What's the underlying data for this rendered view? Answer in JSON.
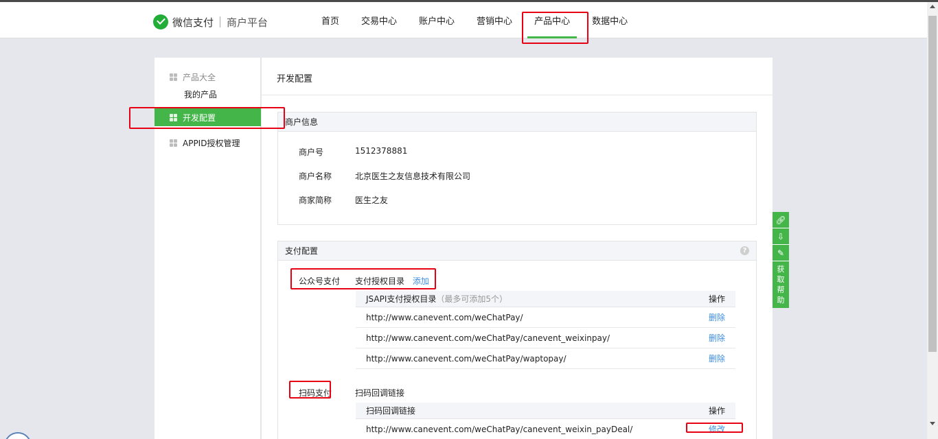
{
  "brand": {
    "name": "微信支付",
    "sub": "商户平台"
  },
  "nav": [
    "首页",
    "交易中心",
    "账户中心",
    "营销中心",
    "产品中心",
    "数据中心"
  ],
  "sidebar": {
    "group1": "产品大全",
    "my_products": "我的产品",
    "active": "开发配置",
    "appid": "APPID授权管理"
  },
  "main": {
    "title": "开发配置",
    "merchant": {
      "head": "商户信息",
      "rows": [
        {
          "k": "商户号",
          "v": "1512378881"
        },
        {
          "k": "商户名称",
          "v": "北京医生之友信息技术有限公司"
        },
        {
          "k": "商家简称",
          "v": "医生之友"
        }
      ]
    },
    "pay": {
      "head": "支付配置",
      "help": "?",
      "jsapi": {
        "label": "公众号支付",
        "title": "支付授权目录",
        "add": "添加",
        "table_head": "JSAPI支付授权目录",
        "table_note": "（最多可添加5个）",
        "op": "操作",
        "rows": [
          {
            "url": "http://www.canevent.com/weChatPay/",
            "action": "删除"
          },
          {
            "url": "http://www.canevent.com/weChatPay/canevent_weixinpay/",
            "action": "删除"
          },
          {
            "url": "http://www.canevent.com/weChatPay/waptopay/",
            "action": "删除"
          }
        ]
      },
      "native": {
        "label": "扫码支付",
        "title": "扫码回调链接",
        "table_head": "扫码回调链接",
        "op": "操作",
        "rows": [
          {
            "url": "http://www.canevent.com/weChatPay/canevent_weixin_payDeal/",
            "action": "修改"
          }
        ]
      }
    }
  },
  "tools": {
    "help": [
      "获",
      "取",
      "帮",
      "助"
    ]
  }
}
